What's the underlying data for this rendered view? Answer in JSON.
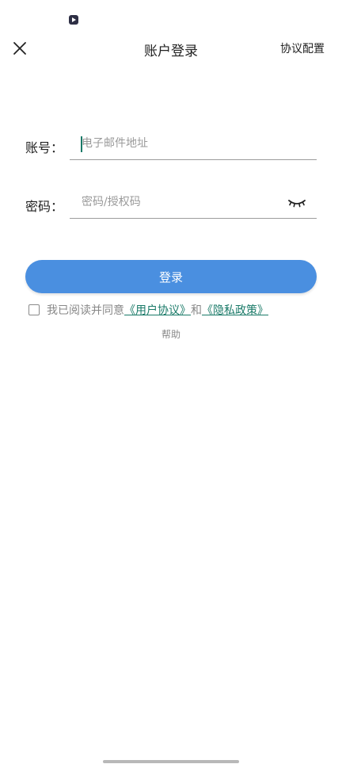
{
  "status_bar": {
    "app_icon": "media-play-icon"
  },
  "header": {
    "close_icon": "close-icon",
    "title": "账户登录",
    "protocol_config_label": "协议配置"
  },
  "form": {
    "account": {
      "label": "账号：",
      "placeholder": "电子邮件地址",
      "value": ""
    },
    "password": {
      "label": "密码：",
      "placeholder": "密码/授权码",
      "value": "",
      "toggle_icon": "eye-closed-icon"
    }
  },
  "login_button_label": "登录",
  "agreement": {
    "checked": false,
    "prefix": "我已阅读并同意",
    "user_agreement_link": "《用户协议》",
    "conjunction": "和",
    "privacy_policy_link": "《隐私政策》"
  },
  "help_label": "帮助",
  "colors": {
    "primary": "#4a8fe0",
    "link": "#1a7a68",
    "muted": "#888888"
  }
}
